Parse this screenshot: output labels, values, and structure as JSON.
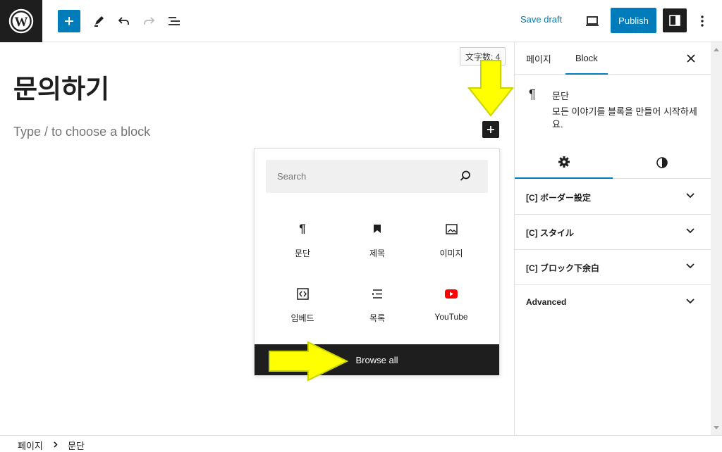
{
  "toolbar": {
    "add_tooltip": "Add block",
    "save_draft": "Save draft",
    "publish": "Publish"
  },
  "editor": {
    "word_count": "文字数: 4",
    "title": "문의하기",
    "placeholder": "Type / to choose a block"
  },
  "inserter": {
    "search_placeholder": "Search",
    "blocks": [
      {
        "label": "문단",
        "icon": "paragraph-icon"
      },
      {
        "label": "제목",
        "icon": "bookmark-icon"
      },
      {
        "label": "이미지",
        "icon": "image-icon"
      },
      {
        "label": "임베드",
        "icon": "embed-icon"
      },
      {
        "label": "목록",
        "icon": "list-icon"
      },
      {
        "label": "YouTube",
        "icon": "youtube-icon"
      }
    ],
    "browse_all": "Browse all"
  },
  "sidebar": {
    "tabs": [
      {
        "label": "페이지"
      },
      {
        "label": "Block"
      }
    ],
    "block_card": {
      "icon": "¶",
      "title": "문단",
      "description": "모든 이야기를 블록을 만들어 시작하세요."
    },
    "panels": [
      {
        "title": "[C] ボーダー設定"
      },
      {
        "title": "[C] スタイル"
      },
      {
        "title": "[C] ブロック下余白"
      },
      {
        "title": "Advanced"
      }
    ]
  },
  "breadcrumb": {
    "items": [
      "페이지",
      "문단"
    ]
  },
  "colors": {
    "accent": "#007cba",
    "dark": "#1e1e1e",
    "annotation_arrow": "#ffff00",
    "youtube": "#ff0000"
  }
}
